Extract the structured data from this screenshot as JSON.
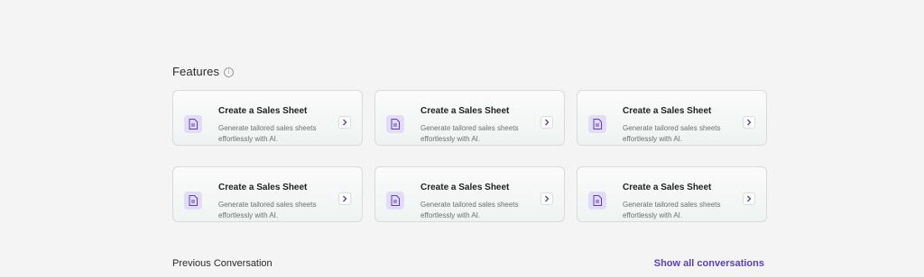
{
  "features": {
    "title": "Features",
    "info_glyph": "i",
    "cards": [
      {
        "title": "Create a Sales Sheet",
        "description": "Generate tailored sales sheets effortlessly with AI.",
        "icon": "document-icon"
      },
      {
        "title": "Create a Sales Sheet",
        "description": "Generate tailored sales sheets effortlessly with AI.",
        "icon": "document-icon"
      },
      {
        "title": "Create a Sales Sheet",
        "description": "Generate tailored sales sheets effortlessly with AI.",
        "icon": "document-icon"
      },
      {
        "title": "Create a Sales Sheet",
        "description": "Generate tailored sales sheets effortlessly with AI.",
        "icon": "document-icon"
      },
      {
        "title": "Create a Sales Sheet",
        "description": "Generate tailored sales sheets effortlessly with AI.",
        "icon": "document-icon"
      },
      {
        "title": "Create a Sales Sheet",
        "description": "Generate tailored sales sheets effortlessly with AI.",
        "icon": "document-icon"
      }
    ]
  },
  "previous_conversation": {
    "title": "Previous Conversation",
    "show_all_label": "Show all conversations"
  },
  "colors": {
    "accent": "#5b3fc4",
    "icon_tile": "#e3dcf6"
  }
}
